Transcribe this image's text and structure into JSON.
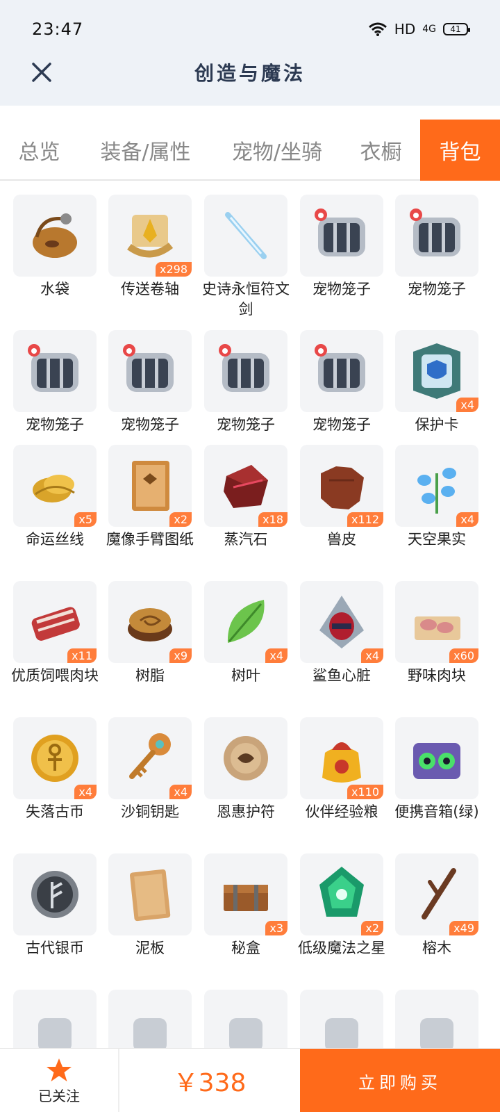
{
  "status_bar": {
    "time": "23:47",
    "network": "HD",
    "signal": "4G",
    "battery": "41"
  },
  "header": {
    "title": "创造与魔法"
  },
  "tabs": [
    {
      "label": "总览",
      "active": false
    },
    {
      "label": "装备/属性",
      "active": false
    },
    {
      "label": "宠物/坐骑",
      "active": false
    },
    {
      "label": "衣橱",
      "active": false
    },
    {
      "label": "背包",
      "active": true
    }
  ],
  "items": [
    {
      "name": "水袋",
      "qty": "",
      "icon": "water-bag-icon"
    },
    {
      "name": "传送卷轴",
      "qty": "x298",
      "icon": "teleport-scroll-icon"
    },
    {
      "name": "史诗永恒符文剑",
      "qty": "",
      "icon": "rune-sword-icon"
    },
    {
      "name": "宠物笼子",
      "qty": "",
      "icon": "pet-cage-icon"
    },
    {
      "name": "宠物笼子",
      "qty": "",
      "icon": "pet-cage-icon"
    },
    {
      "name": "宠物笼子",
      "qty": "",
      "icon": "pet-cage-icon"
    },
    {
      "name": "宠物笼子",
      "qty": "",
      "icon": "pet-cage-icon"
    },
    {
      "name": "宠物笼子",
      "qty": "",
      "icon": "pet-cage-icon"
    },
    {
      "name": "宠物笼子",
      "qty": "",
      "icon": "pet-cage-icon"
    },
    {
      "name": "保护卡",
      "qty": "x4",
      "icon": "protection-card-icon"
    },
    {
      "name": "命运丝线",
      "qty": "x5",
      "icon": "fate-thread-icon"
    },
    {
      "name": "魔像手臂图纸",
      "qty": "x2",
      "icon": "blueprint-icon"
    },
    {
      "name": "蒸汽石",
      "qty": "x18",
      "icon": "steam-stone-icon"
    },
    {
      "name": "兽皮",
      "qty": "x112",
      "icon": "hide-icon"
    },
    {
      "name": "天空果实",
      "qty": "x4",
      "icon": "sky-fruit-icon"
    },
    {
      "name": "优质饲喂肉块",
      "qty": "x11",
      "icon": "meat-icon"
    },
    {
      "name": "树脂",
      "qty": "x9",
      "icon": "resin-icon"
    },
    {
      "name": "树叶",
      "qty": "x4",
      "icon": "leaf-icon"
    },
    {
      "name": "鲨鱼心脏",
      "qty": "x4",
      "icon": "shark-heart-icon"
    },
    {
      "name": "野味肉块",
      "qty": "x60",
      "icon": "game-meat-icon"
    },
    {
      "name": "失落古币",
      "qty": "x4",
      "icon": "gold-coin-icon"
    },
    {
      "name": "沙铜钥匙",
      "qty": "x4",
      "icon": "bronze-key-icon"
    },
    {
      "name": "恩惠护符",
      "qty": "",
      "icon": "amulet-icon"
    },
    {
      "name": "伙伴经验粮",
      "qty": "x110",
      "icon": "exp-bag-icon"
    },
    {
      "name": "便携音箱(绿)",
      "qty": "",
      "icon": "speaker-icon"
    },
    {
      "name": "古代银币",
      "qty": "",
      "icon": "silver-coin-icon"
    },
    {
      "name": "泥板",
      "qty": "",
      "icon": "clay-tablet-icon"
    },
    {
      "name": "秘盒",
      "qty": "x3",
      "icon": "secret-box-icon"
    },
    {
      "name": "低级魔法之星",
      "qty": "x2",
      "icon": "magic-star-icon"
    },
    {
      "name": "榕木",
      "qty": "x49",
      "icon": "banyan-wood-icon"
    },
    {
      "name": "",
      "qty": "",
      "icon": "partial-item-icon"
    },
    {
      "name": "",
      "qty": "",
      "icon": "partial-item-icon"
    },
    {
      "name": "",
      "qty": "",
      "icon": "partial-item-icon"
    },
    {
      "name": "",
      "qty": "",
      "icon": "partial-item-icon"
    },
    {
      "name": "",
      "qty": "",
      "icon": "partial-item-icon"
    }
  ],
  "bottom": {
    "follow_label": "已关注",
    "price": "￥338",
    "buy_label": "立即购买"
  },
  "colors": {
    "accent": "#ff6a1a",
    "qty_badge": "#ff7d3b",
    "header_bg": "#eef2f7"
  }
}
